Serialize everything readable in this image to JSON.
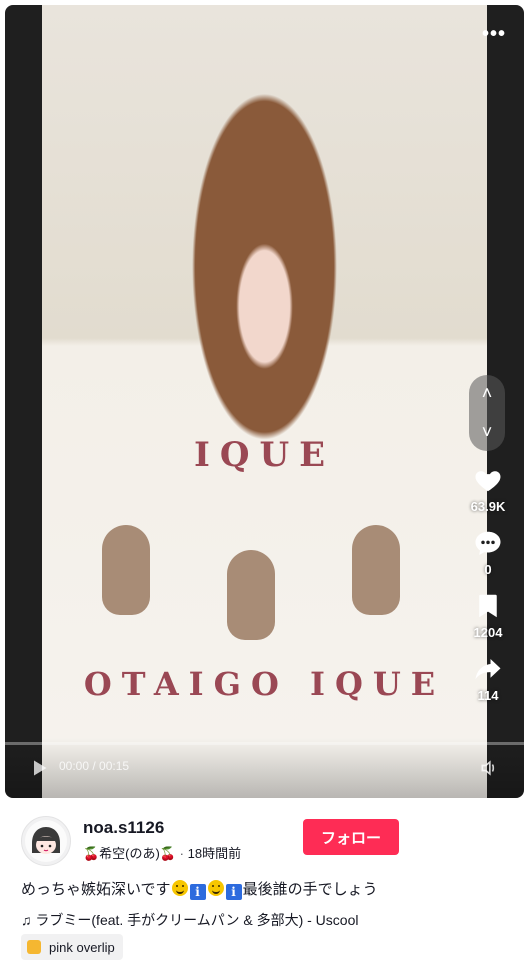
{
  "player": {
    "more_label": "•••",
    "time": "00:00 / 00:15",
    "actions": [
      {
        "name": "like",
        "count": "63.9K"
      },
      {
        "name": "comment",
        "count": "0"
      },
      {
        "name": "save",
        "count": "1204"
      },
      {
        "name": "share",
        "count": "114"
      }
    ],
    "nav": {
      "up": "˄",
      "down": "˅"
    },
    "sweater": {
      "line1": "IQUE",
      "line2": "OTAIGO",
      "line3": "OTAIGO  IQUE"
    }
  },
  "author": {
    "username": "noa.s1126",
    "display_name": "🍒希空(のあ)🍒",
    "separator": "·",
    "posted": "18時間前",
    "follow_label": "フォロー"
  },
  "description": {
    "part1": "めっちゃ嫉妬深いです",
    "info1": "i",
    "info2": "i",
    "part2": "最後誰の手でしょう"
  },
  "music": {
    "note": "♫",
    "title": "ラブミー(feat. 手がクリームパン & 多部大) - Uscool"
  },
  "effect": {
    "label": "pink overlip"
  },
  "colors": {
    "follow": "#fe2c55",
    "text": "#161823",
    "chip": "#f1f1f2"
  }
}
